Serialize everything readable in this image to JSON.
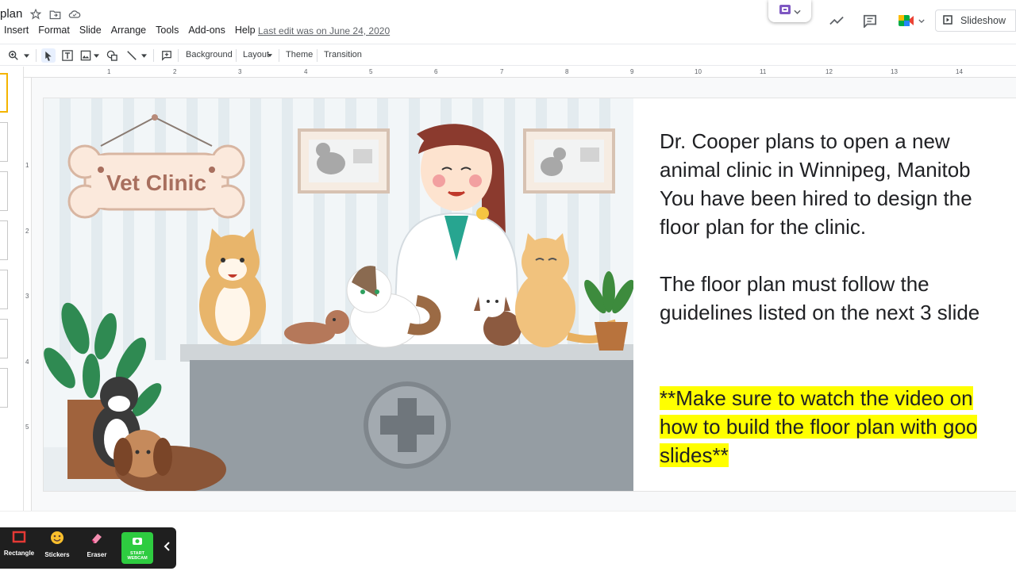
{
  "header": {
    "doc_title": "plan",
    "menu": [
      "Insert",
      "Format",
      "Slide",
      "Arrange",
      "Tools",
      "Add-ons",
      "Help"
    ],
    "last_edit": "Last edit was on June 24, 2020",
    "slideshow_label": "Slideshow"
  },
  "toolbar": {
    "background_label": "Background",
    "layout_label": "Layout",
    "theme_label": "Theme",
    "transition_label": "Transition"
  },
  "ruler": {
    "numbers": [
      "1",
      "2",
      "3",
      "4",
      "5",
      "6",
      "7",
      "8",
      "9",
      "10",
      "11",
      "12",
      "13",
      "14"
    ],
    "vertical_numbers": [
      "1",
      "2",
      "3",
      "4",
      "5"
    ]
  },
  "slide": {
    "sign_text": "Vet Clinic",
    "paragraph1": [
      "Dr. Cooper plans to open a new",
      "animal clinic in Winnipeg, Manitob",
      "You have been hired to design the",
      "floor plan for the clinic."
    ],
    "paragraph2": [
      "The floor plan must follow the",
      "guidelines listed on the next 3 slide"
    ],
    "note": [
      "**Make sure to watch the video on",
      "how to build the floor plan with goo",
      "slides**"
    ]
  },
  "recorder": {
    "tools": [
      "Rectangle",
      "Stickers",
      "Eraser"
    ],
    "webcam_label": [
      "START",
      "WEBCAM"
    ]
  },
  "colors": {
    "highlight": "#ffff00",
    "active_thumb": "#f4b400",
    "recorder_bg": "#1f1f1f",
    "webcam": "#2ecc40"
  }
}
